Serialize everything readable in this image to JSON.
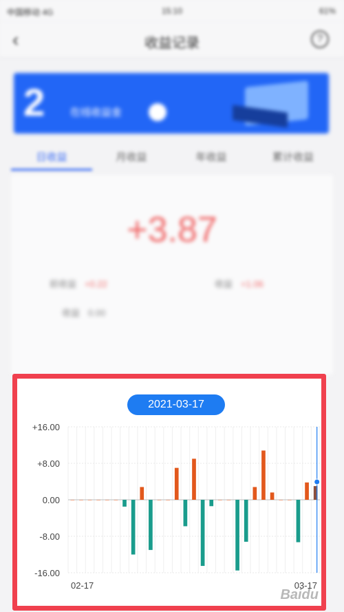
{
  "status_bar": {
    "carrier": "中国移动 4G",
    "time": "15:10",
    "battery": "61%"
  },
  "nav": {
    "title": "收益记录"
  },
  "banner": {
    "big_number": "2",
    "text": "在线收益金"
  },
  "tabs": [
    {
      "label": "日收益",
      "active": true
    },
    {
      "label": "月收益",
      "active": false
    },
    {
      "label": "年收益",
      "active": false
    },
    {
      "label": "累计收益",
      "active": false
    }
  ],
  "summary": {
    "value": "+3.87",
    "row1_label": "前收益",
    "row1_value": "+0.22",
    "row2_label": "收益",
    "row2_value": "+1.06",
    "row3_label": "收益",
    "row3_value": "0.00"
  },
  "chart_date": "2021-03-17",
  "watermark": "Baidu",
  "colors": {
    "positive": "#e2581c",
    "negative": "#1a9c8c",
    "selected": "#8a5040",
    "accent": "#1e7cf2",
    "highlight": "#f0404e"
  },
  "chart_data": {
    "type": "bar",
    "ylim": [
      -16,
      16
    ],
    "y_ticks": [
      "+16.00",
      "+8.00",
      "0.00",
      "-8.00",
      "-16.00"
    ],
    "x_tick_labels": [
      "02-17",
      "03-17"
    ],
    "selected_label": "2021-03-17",
    "values": [
      0,
      0,
      0,
      0,
      0,
      0,
      -1.5,
      -12,
      2.8,
      -11,
      0,
      0,
      7,
      -5.8,
      9,
      -14.5,
      -1.4,
      0,
      0,
      -15.5,
      -9.2,
      2.8,
      10.8,
      1.6,
      0,
      0,
      -9.3,
      3.8,
      3.0
    ]
  }
}
